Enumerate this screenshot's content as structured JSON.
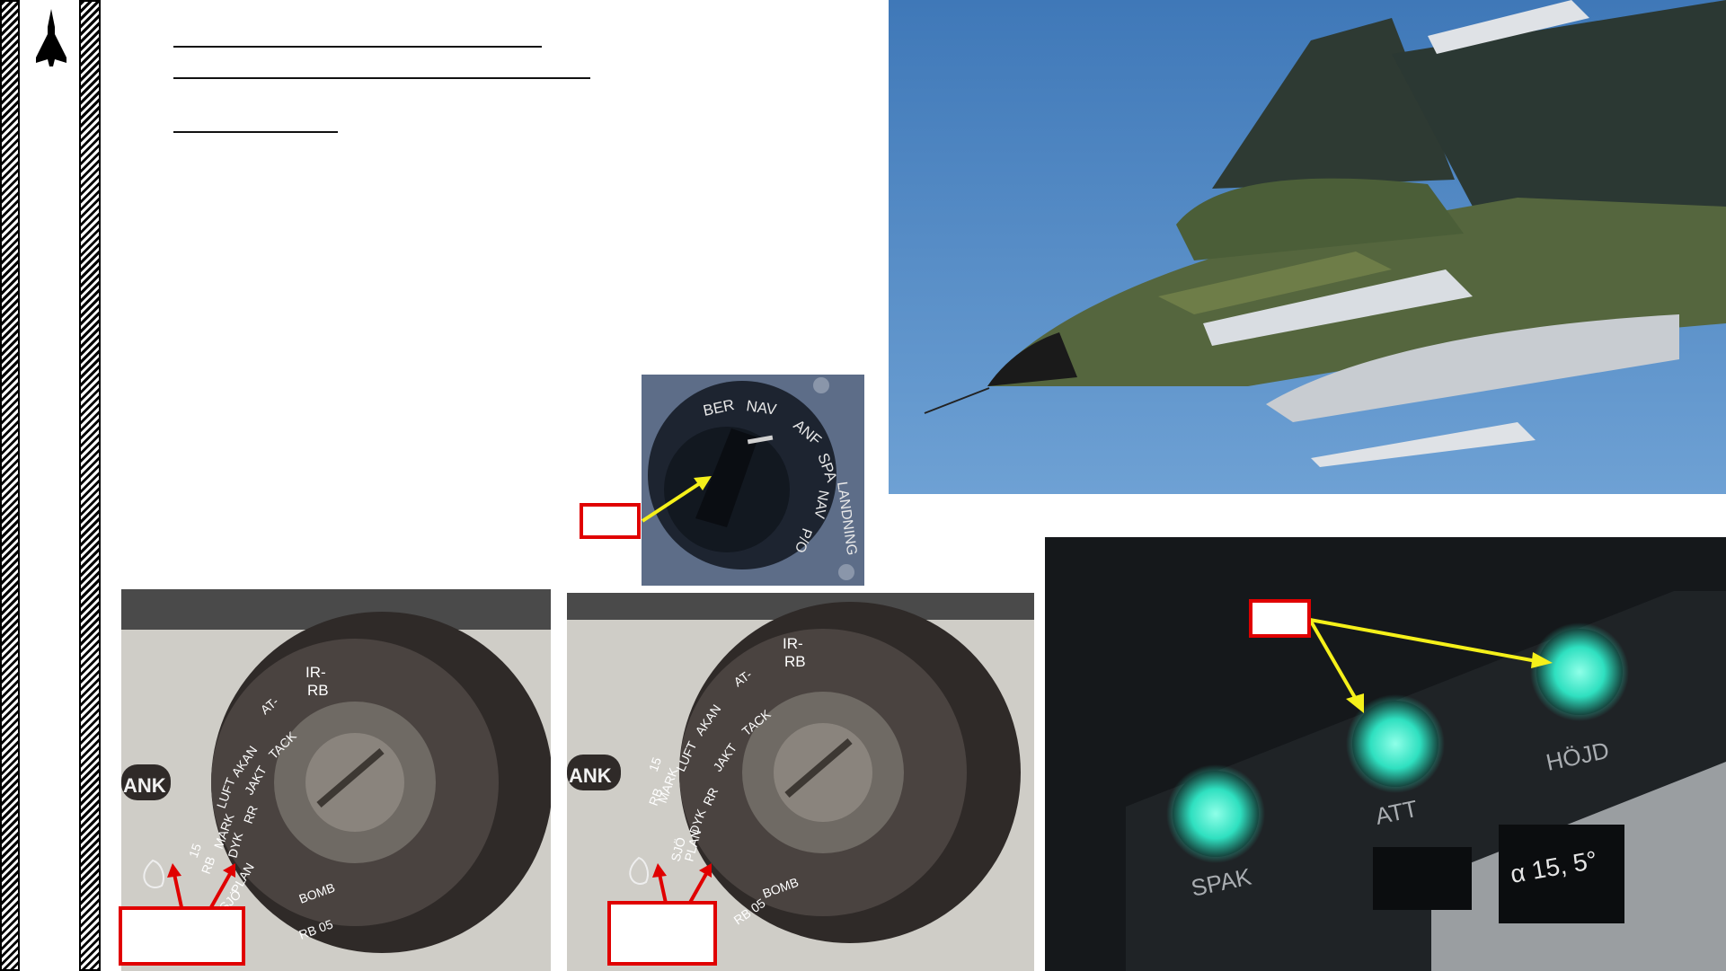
{
  "sidebar": {
    "logo_icon": "jet-silhouette-icon"
  },
  "photos": {
    "aircraft": {
      "icon": "aircraft-photo"
    },
    "nav_selector": {
      "labels": [
        "BER",
        "NAV",
        "ANF",
        "SPA",
        "LANDNING",
        "NAV",
        "P/O"
      ]
    },
    "weapon_selector_left": {
      "labels": [
        "ANK",
        "15",
        "RB",
        "MARK",
        "LUFT",
        "AKAN",
        "AT-",
        "TACK",
        "JAKT",
        "IR-",
        "RB",
        "RR",
        "DYK",
        "PLAN",
        "SJÖ",
        "BOMB",
        "RB 05"
      ]
    },
    "weapon_selector_right": {
      "labels": [
        "ANK",
        "15",
        "RB",
        "MARK",
        "LUFT",
        "AKAN",
        "AT-",
        "TACK",
        "JAKT",
        "IR-",
        "RB",
        "RR",
        "DYK",
        "PLAN",
        "SJÖ",
        "BOMB",
        "RB 05"
      ]
    },
    "warning_lights": {
      "labels": [
        "SPAK",
        "ATT",
        "HÖJD"
      ],
      "alpha_readout": "α 15, 5°",
      "light_color": "#2fe0c0"
    }
  },
  "colors": {
    "callout_box": "#e00000",
    "arrow_yellow": "#f5f01a",
    "arrow_red": "#e00000"
  }
}
